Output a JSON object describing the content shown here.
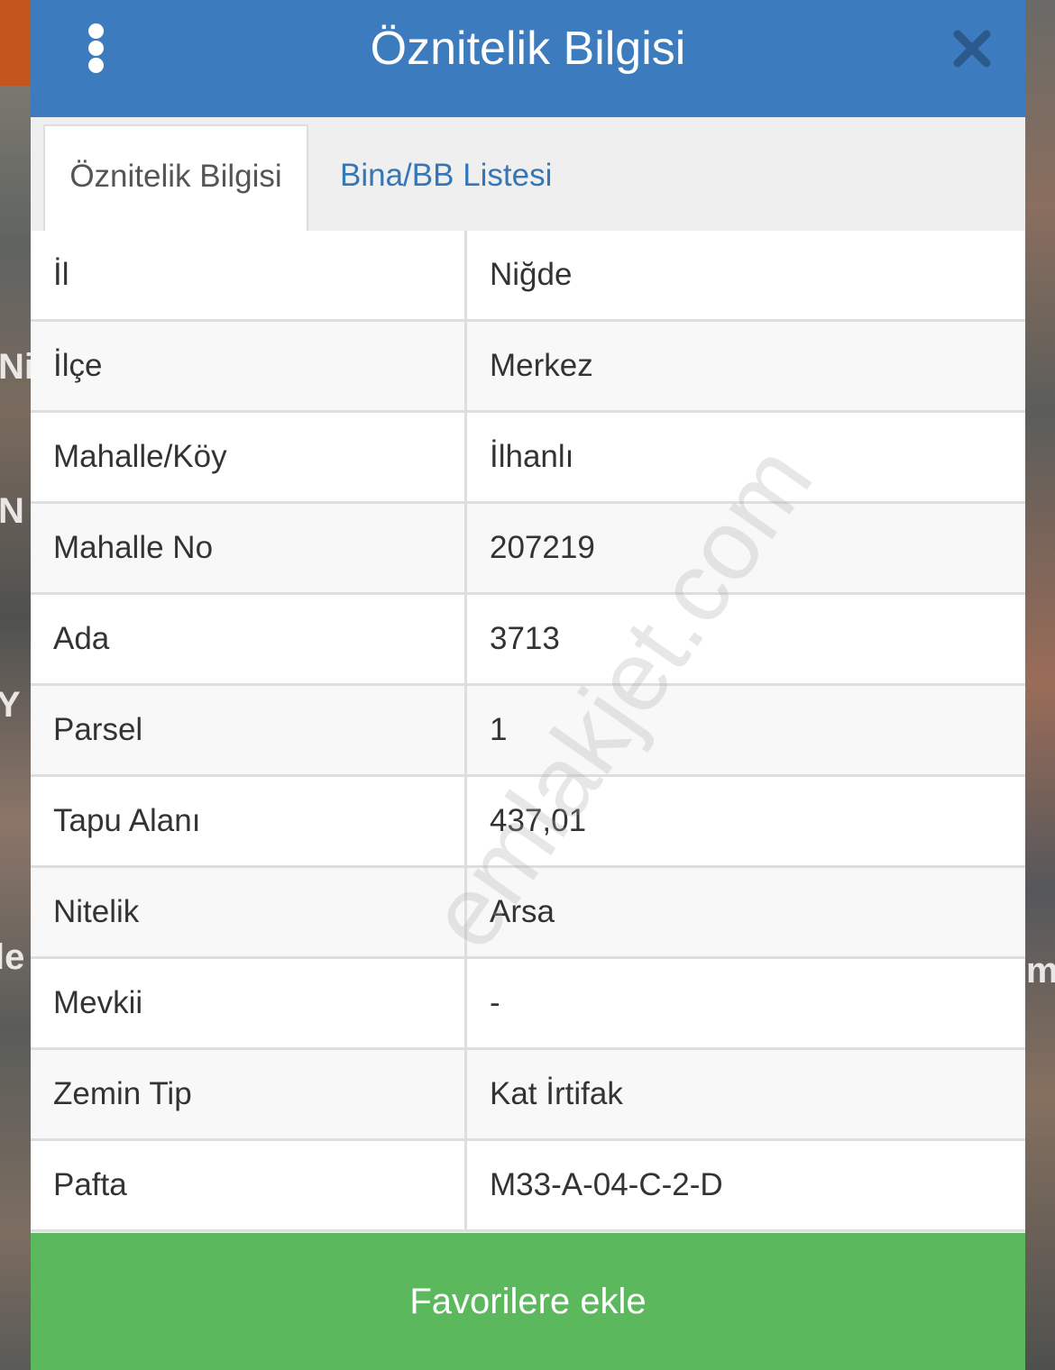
{
  "header": {
    "title": "Öznitelik Bilgisi",
    "menu_icon": "vertical-dots-icon",
    "close_icon": "close-icon",
    "color": "#3c7bbd"
  },
  "tabs": [
    {
      "label": "Öznitelik Bilgisi",
      "active": true
    },
    {
      "label": "Bina/BB Listesi",
      "active": false
    }
  ],
  "attributes": [
    {
      "label": "İl",
      "value": "Niğde"
    },
    {
      "label": "İlçe",
      "value": "Merkez"
    },
    {
      "label": "Mahalle/Köy",
      "value": "İlhanlı"
    },
    {
      "label": "Mahalle No",
      "value": "207219"
    },
    {
      "label": "Ada",
      "value": "3713"
    },
    {
      "label": "Parsel",
      "value": "1"
    },
    {
      "label": "Tapu Alanı",
      "value": "437,01"
    },
    {
      "label": "Nitelik",
      "value": "Arsa"
    },
    {
      "label": "Mevkii",
      "value": "-"
    },
    {
      "label": "Zemin Tip",
      "value": "Kat İrtifak"
    },
    {
      "label": "Pafta",
      "value": "M33-A-04-C-2-D"
    }
  ],
  "footer": {
    "favorite_label": "Favorilere ekle",
    "color": "#5cb85c"
  },
  "watermark": "emlakjet.com",
  "map_labels": [
    "Ni",
    "N",
    "Y",
    "le",
    "m"
  ]
}
